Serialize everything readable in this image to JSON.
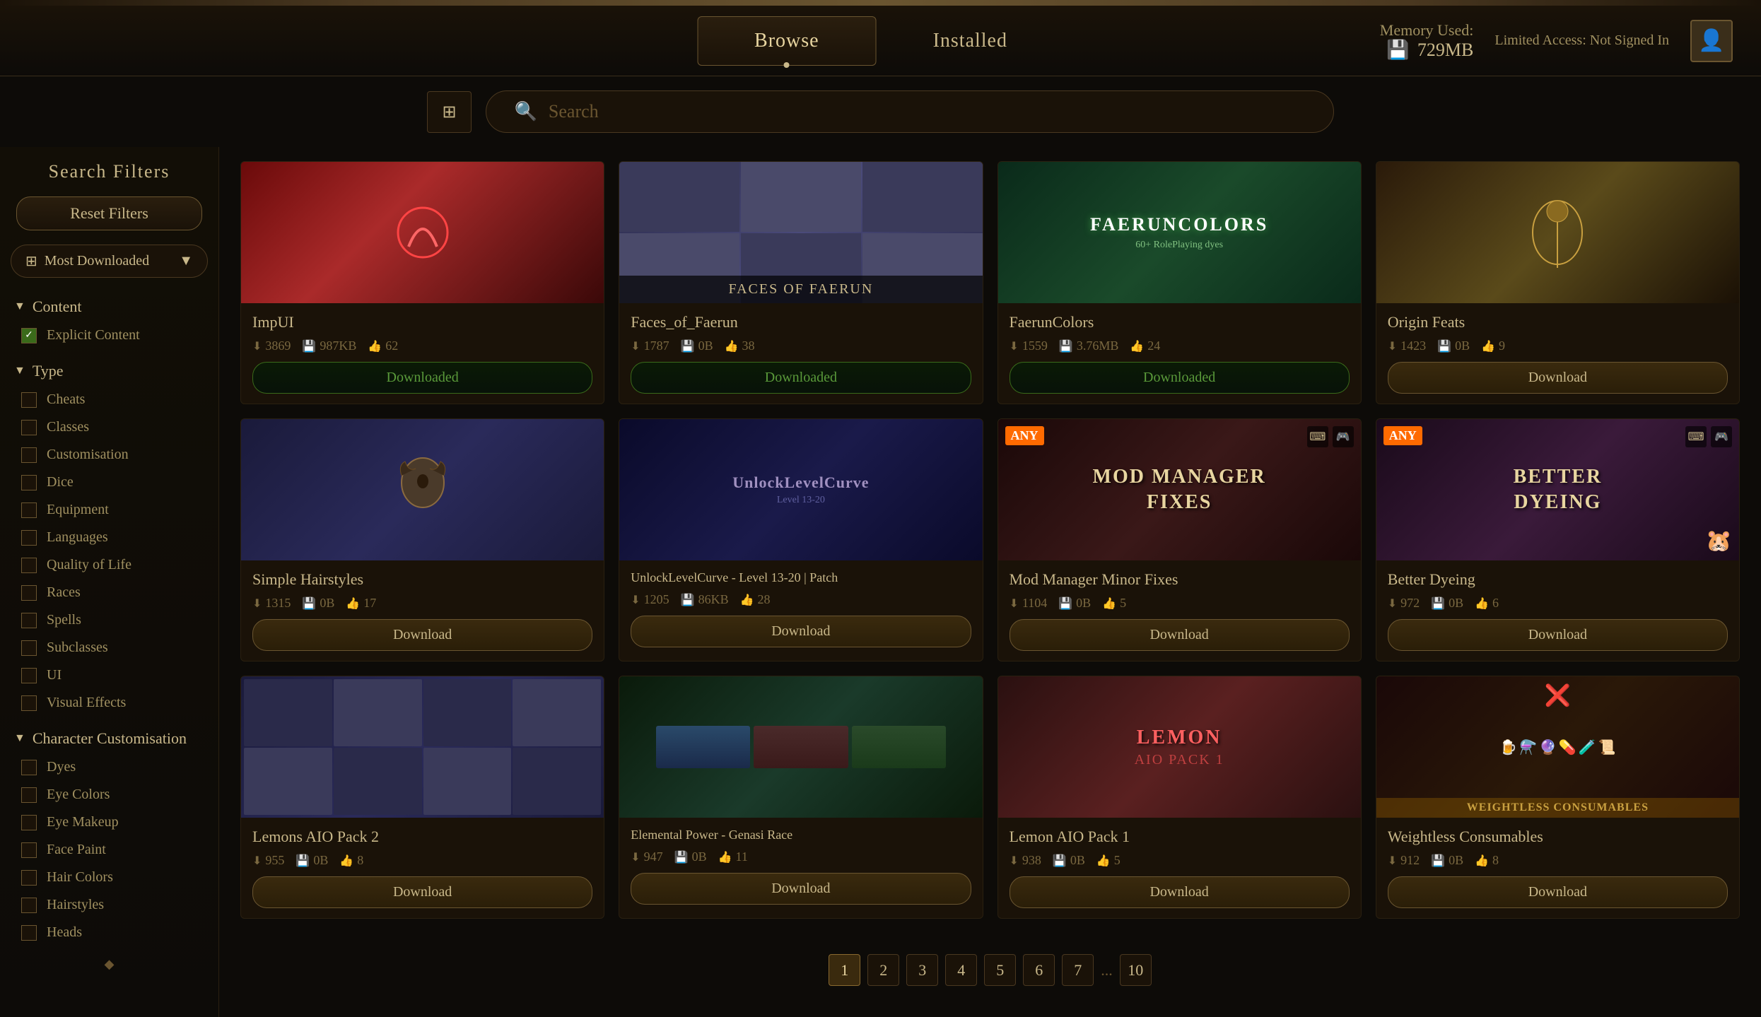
{
  "header": {
    "tabs": [
      {
        "id": "browse",
        "label": "Browse",
        "active": true
      },
      {
        "id": "installed",
        "label": "Installed",
        "active": false
      }
    ],
    "memory": {
      "label": "Memory Used:",
      "icon": "💾",
      "value": "729MB"
    },
    "user": {
      "label": "Limited Access: Not Signed In"
    }
  },
  "search": {
    "placeholder": "Search",
    "filter_icon": "⚙"
  },
  "sidebar": {
    "title": "Search Filters",
    "reset_label": "Reset Filters",
    "sort": {
      "label": "Most Downloaded",
      "icon": "⊞"
    },
    "content_section": {
      "label": "Content",
      "items": [
        {
          "id": "explicit",
          "label": "Explicit Content",
          "checked": true
        }
      ]
    },
    "type_section": {
      "label": "Type",
      "items": [
        {
          "id": "cheats",
          "label": "Cheats",
          "checked": false
        },
        {
          "id": "classes",
          "label": "Classes",
          "checked": false
        },
        {
          "id": "customisation",
          "label": "Customisation",
          "checked": false
        },
        {
          "id": "dice",
          "label": "Dice",
          "checked": false
        },
        {
          "id": "equipment",
          "label": "Equipment",
          "checked": false
        },
        {
          "id": "languages",
          "label": "Languages",
          "checked": false
        },
        {
          "id": "quality",
          "label": "Quality of Life",
          "checked": false
        },
        {
          "id": "races",
          "label": "Races",
          "checked": false
        },
        {
          "id": "spells",
          "label": "Spells",
          "checked": false
        },
        {
          "id": "subclasses",
          "label": "Subclasses",
          "checked": false
        },
        {
          "id": "ui",
          "label": "UI",
          "checked": false
        },
        {
          "id": "visual",
          "label": "Visual Effects",
          "checked": false
        }
      ]
    },
    "char_section": {
      "label": "Character Customisation",
      "items": [
        {
          "id": "dyes",
          "label": "Dyes",
          "checked": false
        },
        {
          "id": "eye-colors",
          "label": "Eye Colors",
          "checked": false
        },
        {
          "id": "eye-makeup",
          "label": "Eye Makeup",
          "checked": false
        },
        {
          "id": "face-paint",
          "label": "Face Paint",
          "checked": false
        },
        {
          "id": "hair-colors",
          "label": "Hair Colors",
          "checked": false
        },
        {
          "id": "hairstyles",
          "label": "Hairstyles",
          "checked": false
        },
        {
          "id": "heads",
          "label": "Heads",
          "checked": false
        }
      ]
    }
  },
  "mods": [
    {
      "id": "impui",
      "name": "ImpUI",
      "downloads": "3869",
      "size": "987KB",
      "likes": "62",
      "status": "Downloaded",
      "thumb_type": "thumb-impui",
      "thumb_text": ""
    },
    {
      "id": "faces",
      "name": "Faces_of_Faerun",
      "downloads": "1787",
      "size": "0B",
      "likes": "38",
      "status": "Downloaded",
      "thumb_type": "thumb-faces",
      "thumb_text": "FACES OF FAERUN"
    },
    {
      "id": "faerun",
      "name": "FaerunColors",
      "downloads": "1559",
      "size": "3.76MB",
      "likes": "24",
      "status": "Downloaded",
      "thumb_type": "thumb-faerun",
      "thumb_text": "FAERUNCOLORS"
    },
    {
      "id": "origin",
      "name": "Origin Feats",
      "downloads": "1423",
      "size": "0B",
      "likes": "9",
      "status": "Download",
      "thumb_type": "thumb-origin",
      "thumb_text": ""
    },
    {
      "id": "hairstyles",
      "name": "Simple Hairstyles",
      "downloads": "1315",
      "size": "0B",
      "likes": "17",
      "status": "Download",
      "thumb_type": "thumb-hairstyles",
      "thumb_text": ""
    },
    {
      "id": "unlock",
      "name": "UnlockLevelCurve - Level 13-20 | Patch",
      "downloads": "1205",
      "size": "86KB",
      "likes": "28",
      "status": "Download",
      "thumb_type": "thumb-unlock",
      "thumb_text": "UnlockLevelCurve"
    },
    {
      "id": "modmanager",
      "name": "Mod Manager Minor Fixes",
      "downloads": "1104",
      "size": "0B",
      "likes": "5",
      "status": "Download",
      "thumb_type": "thumb-modmanager",
      "thumb_text": "MOD MANAGER\nFIXES",
      "has_any": true
    },
    {
      "id": "dyeing",
      "name": "Better Dyeing",
      "downloads": "972",
      "size": "0B",
      "likes": "6",
      "status": "Download",
      "thumb_type": "thumb-dyeing",
      "thumb_text": "BETTER\nDYEING",
      "has_any": true
    },
    {
      "id": "lemons",
      "name": "Lemons AIO Pack 2",
      "downloads": "955",
      "size": "0B",
      "likes": "8",
      "status": "Download",
      "thumb_type": "thumb-lemons",
      "thumb_text": ""
    },
    {
      "id": "elemental",
      "name": "Elemental Power - Genasi Race",
      "downloads": "947",
      "size": "0B",
      "likes": "11",
      "status": "Download",
      "thumb_type": "thumb-elemental",
      "thumb_text": ""
    },
    {
      "id": "lemon",
      "name": "Lemon AIO Pack 1",
      "downloads": "938",
      "size": "0B",
      "likes": "5",
      "status": "Download",
      "thumb_type": "thumb-lemon",
      "thumb_text": "LEMON\nAIO PACK 1"
    },
    {
      "id": "weightless",
      "name": "Weightless Consumables",
      "downloads": "912",
      "size": "0B",
      "likes": "8",
      "status": "Download",
      "thumb_type": "thumb-weightless",
      "thumb_text": "WEIGHTLESS CONSUMABLES"
    }
  ],
  "pagination": {
    "pages": [
      "1",
      "2",
      "3",
      "4",
      "5",
      "6",
      "7",
      "...",
      "10"
    ],
    "current": "1"
  }
}
